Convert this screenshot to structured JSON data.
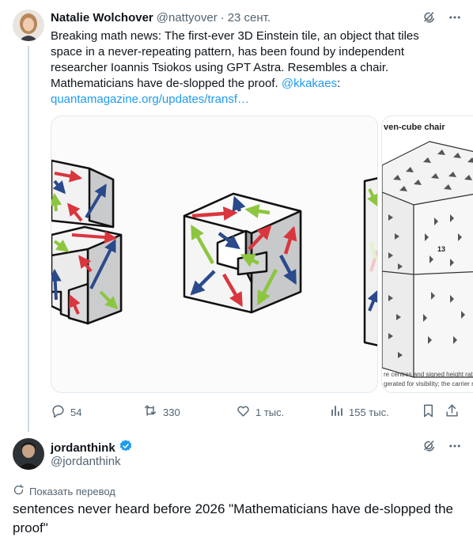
{
  "tweet1": {
    "author_name": "Natalie Wolchover",
    "author_handle": "@nattyover",
    "separator": "·",
    "date": "23 сент.",
    "text_lines": [
      "Breaking math news: The first-ever 3D Einstein tile, an object that tiles",
      "space in a never-repeating pattern, has been found by independent",
      "researcher Ioannis Tsiokos using GPT Astra. Resembles a chair.",
      "Mathematicians have de-slopped the proof. "
    ],
    "mention": "@kkakaes",
    "mention_suffix": ":",
    "link_text": "quantamagazine.org/updates/transf…",
    "media": {
      "second_image_caption": "ven-cube chair",
      "second_image_number": "13",
      "second_image_footer_1": "re centres and signed height rat",
      "second_image_footer_2": "gerated for visibility; the carrier re"
    },
    "actions": {
      "replies": "54",
      "reposts": "330",
      "likes": "1 тыс.",
      "views": "155 тыс."
    }
  },
  "tweet2": {
    "author_name": "jordanthink",
    "author_handle": "@jordanthink",
    "verified": true,
    "translate_label": "Показать перевод",
    "text": "sentences never heard before 2026 \"Mathematicians have de-slopped the proof\""
  },
  "icons": {
    "grok": "grok-icon",
    "more": "more-icon",
    "reply": "reply-icon",
    "repost": "repost-icon",
    "like": "like-icon",
    "views": "views-icon",
    "bookmark": "bookmark-icon",
    "share": "share-icon",
    "verified": "verified-badge-icon",
    "translate": "translate-icon"
  },
  "colors": {
    "text": "#0f1419",
    "secondary": "#536471",
    "link": "#1d9bf0",
    "verified": "#1d9bf0",
    "arrow_red": "#d9363e",
    "arrow_blue": "#2a4a8c",
    "arrow_green": "#8cc63f"
  }
}
